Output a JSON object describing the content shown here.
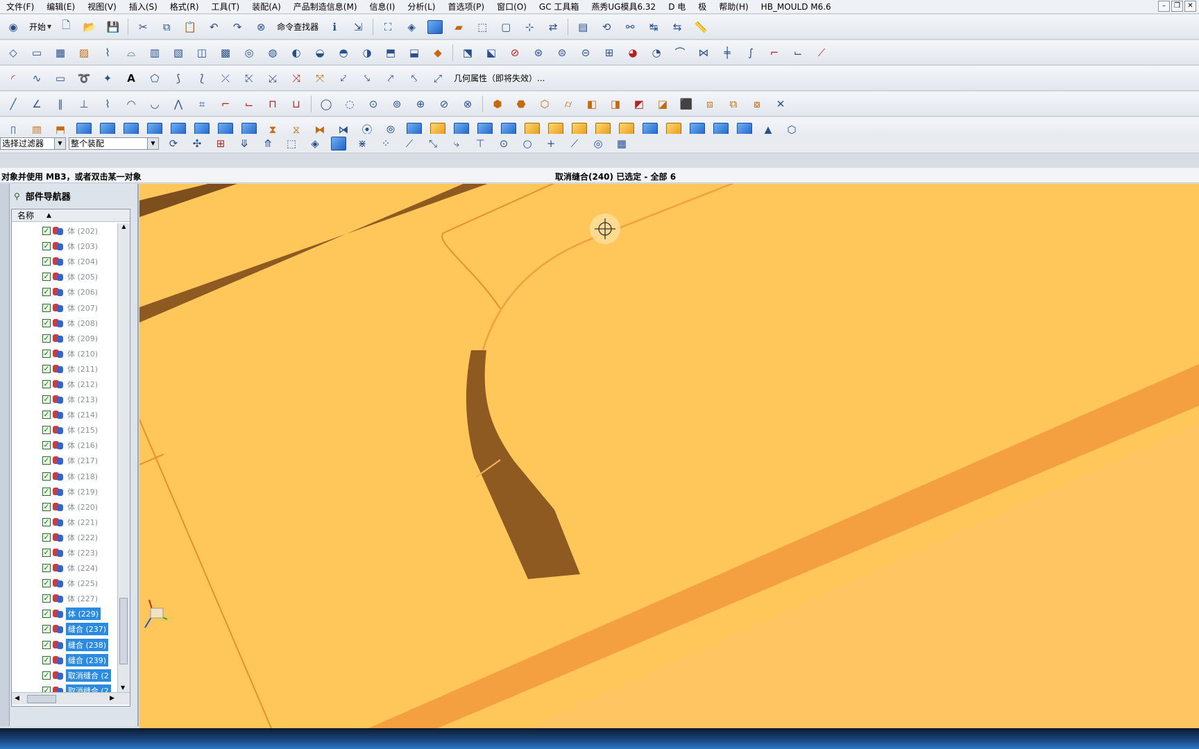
{
  "menubar": {
    "items": [
      "文件(F)",
      "编辑(E)",
      "视图(V)",
      "插入(S)",
      "格式(R)",
      "工具(T)",
      "装配(A)",
      "产品制造信息(M)",
      "信息(I)",
      "分析(L)",
      "首选项(P)",
      "窗口(O)",
      "GC 工具箱",
      "燕秀UG模具6.32",
      "D 电",
      "极",
      "帮助(H)",
      "HB_MOULD M6.6"
    ]
  },
  "toolbar": {
    "start_label": "开始",
    "command_finder_label": "命令查找器",
    "geometry_attr_label": "几何属性（即将失效）..."
  },
  "filterbar": {
    "type_filter_value": "选择过滤器",
    "scope_filter_value": "整个装配"
  },
  "status": {
    "prompt": "对象并使用 MB3，或者双击某一对象",
    "selection_info": "取消缝合(240) 已选定 - 全部 6"
  },
  "navigator": {
    "title": "部件导航器",
    "column_header": "名称",
    "rows": [
      {
        "label": "体 (202)",
        "selected": false
      },
      {
        "label": "体 (203)",
        "selected": false
      },
      {
        "label": "体 (204)",
        "selected": false
      },
      {
        "label": "体 (205)",
        "selected": false
      },
      {
        "label": "体 (206)",
        "selected": false
      },
      {
        "label": "体 (207)",
        "selected": false
      },
      {
        "label": "体 (208)",
        "selected": false
      },
      {
        "label": "体 (209)",
        "selected": false
      },
      {
        "label": "体 (210)",
        "selected": false
      },
      {
        "label": "体 (211)",
        "selected": false
      },
      {
        "label": "体 (212)",
        "selected": false
      },
      {
        "label": "体 (213)",
        "selected": false
      },
      {
        "label": "体 (214)",
        "selected": false
      },
      {
        "label": "体 (215)",
        "selected": false
      },
      {
        "label": "体 (216)",
        "selected": false
      },
      {
        "label": "体 (217)",
        "selected": false
      },
      {
        "label": "体 (218)",
        "selected": false
      },
      {
        "label": "体 (219)",
        "selected": false
      },
      {
        "label": "体 (220)",
        "selected": false
      },
      {
        "label": "体 (221)",
        "selected": false
      },
      {
        "label": "体 (222)",
        "selected": false
      },
      {
        "label": "体 (223)",
        "selected": false
      },
      {
        "label": "体 (224)",
        "selected": false
      },
      {
        "label": "体 (225)",
        "selected": false
      },
      {
        "label": "体 (227)",
        "selected": false
      },
      {
        "label": "体 (229)",
        "selected": true
      },
      {
        "label": "缝合 (237)",
        "selected": true
      },
      {
        "label": "缝合 (238)",
        "selected": true
      },
      {
        "label": "缝合 (239)",
        "selected": true
      },
      {
        "label": "取消缝合 (2",
        "selected": true
      },
      {
        "label": "取消缝合 (2",
        "selected": true
      }
    ]
  },
  "colors": {
    "model_face": "#ffc75a",
    "model_shadow": "#8f5a22",
    "model_edge": "#f59a3a",
    "selection": "#2b8be0"
  }
}
